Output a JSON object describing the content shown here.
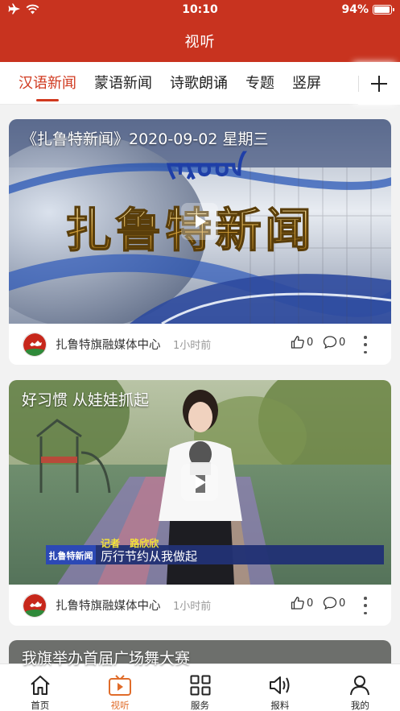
{
  "status_bar": {
    "time": "10:10",
    "battery": "94%",
    "battery_level": 0.94
  },
  "header": {
    "title": "视听",
    "background_color": "#c8331f"
  },
  "channel_tabs": {
    "items": [
      {
        "label": "汉语新闻",
        "active": true
      },
      {
        "label": "蒙语新闻",
        "active": false
      },
      {
        "label": "诗歌朗诵",
        "active": false
      },
      {
        "label": "专题",
        "active": false
      },
      {
        "label": "竖屏",
        "active": false
      }
    ],
    "add_icon": "plus-icon",
    "active_color": "#d0391f"
  },
  "feed": {
    "items": [
      {
        "title": "《扎鲁特新闻》2020-09-02 星期三",
        "thumbnail_text": "扎鲁特新闻",
        "thumbnail_mongolian": "ᠵᠠᠷᠤᠳ",
        "source": "扎鲁特旗融媒体中心",
        "time": "1小时前",
        "likes": "0",
        "comments": "0"
      },
      {
        "title": "好习惯 从娃娃抓起",
        "lower_third_label": "记者",
        "lower_third_name": "路欣欣",
        "lower_third_logo": "扎鲁特新闻",
        "lower_third_caption": "厉行节约从我做起",
        "source": "扎鲁特旗融媒体中心",
        "time": "1小时前",
        "likes": "0",
        "comments": "0"
      },
      {
        "title": "我旗举办首届广场舞大赛"
      }
    ]
  },
  "bottom_nav": {
    "items": [
      {
        "label": "首页",
        "icon": "home-icon",
        "active": false
      },
      {
        "label": "视听",
        "icon": "tv-play-icon",
        "active": true
      },
      {
        "label": "服务",
        "icon": "grid-icon",
        "active": false
      },
      {
        "label": "报料",
        "icon": "speaker-icon",
        "active": false
      },
      {
        "label": "我的",
        "icon": "person-icon",
        "active": false
      }
    ],
    "active_color": "#e06c2a"
  }
}
